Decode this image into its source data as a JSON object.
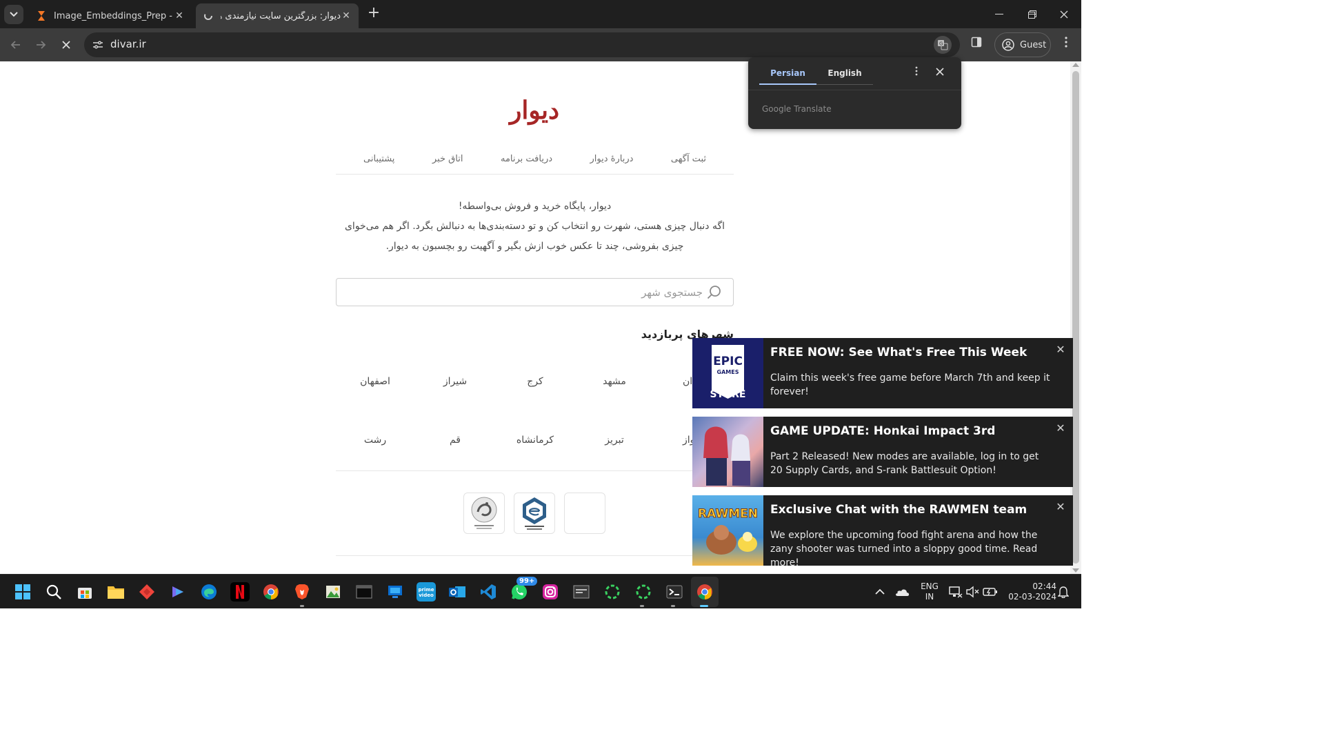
{
  "browser": {
    "tabs": [
      {
        "title": "Image_Embeddings_Prep - Jupy",
        "icon": "jupyter-hourglass-icon"
      },
      {
        "title": "دیوار: بزرگترین سایت نیازمندی های",
        "icon": "divar-loading-icon"
      }
    ],
    "address": "divar.ir",
    "profile_label": "Guest"
  },
  "translate_popup": {
    "source_language": "Persian",
    "target_language": "English",
    "brand": "Google Translate",
    "accent_color": "#a8c7fa"
  },
  "page": {
    "logo": "دیوار",
    "nav": [
      "ثبت آگهی",
      "دربارهٔ دیوار",
      "دریافت برنامه",
      "اتاق خبر",
      "پشتیبانی"
    ],
    "intro_line1": "دیوار، پایگاه خرید و فروش بی‌واسطه!",
    "intro_line2": "اگه دنبال چیزی هستی، شهرت رو انتخاب کن و تو دسته‌بندی‌ها به دنبالش بگرد. اگر هم می‌خوای چیزی بفروشی، چند تا عکس خوب ازش بگیر و آگهیت رو بچسبون به دیوار.",
    "search_placeholder": "جستجوی شهر",
    "cities_title": "شهرهای پربازدید",
    "cities_row1": [
      "ان",
      "مشهد",
      "کرج",
      "شیراز",
      "اصفهان"
    ],
    "cities_row2": [
      "واز",
      "تبریز",
      "کرمانشاه",
      "قم",
      "رشت"
    ],
    "brand_color": "#a62626"
  },
  "notifications": [
    {
      "title": "FREE NOW: See What's Free This Week",
      "body": "Claim this week's free game before March 7th and keep it forever!",
      "thumb_text_top": "EPIC",
      "thumb_text_mid": "GAMES",
      "thumb_text_bottom": "STORE"
    },
    {
      "title": "GAME UPDATE: Honkai Impact 3rd",
      "body": "Part 2 Released! New modes are available, log in to get 20 Supply Cards, and S-rank Battlesuit Option!"
    },
    {
      "title": "Exclusive Chat with the RAWMEN team",
      "body": "We explore the upcoming food fight arena and how the zany shooter was turned into a sloppy good time. Read more!",
      "thumb_text": "RAWMEN"
    }
  ],
  "taskbar": {
    "whatsapp_badge": "99+",
    "language": "ENG",
    "region": "IN",
    "time": "02:44",
    "date": "02-03-2024"
  }
}
